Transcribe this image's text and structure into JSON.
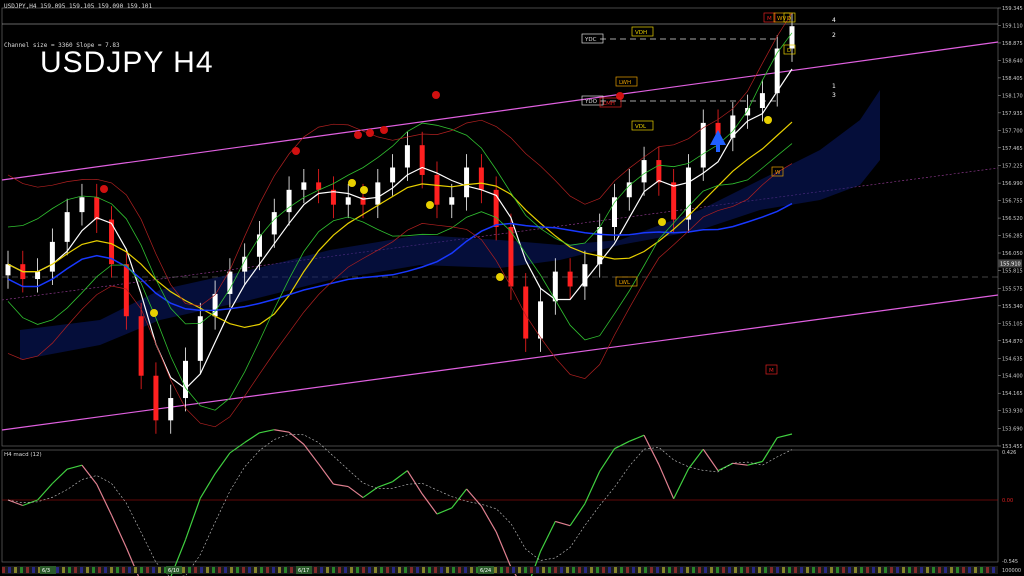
{
  "header": {
    "symbol_line": "USDJPY,H4  159.095 159.105 159.090 159.101",
    "channel_info": "Channel size = 3360 Slope = 7.83",
    "big_title": "USDJPY H4"
  },
  "price_axis": {
    "ticks": [
      "159.345",
      "159.110",
      "158.875",
      "158.640",
      "158.405",
      "158.170",
      "157.935",
      "157.700",
      "157.465",
      "157.225",
      "156.990",
      "156.755",
      "156.520",
      "156.285",
      "156.050",
      "155.815",
      "155.575",
      "155.340",
      "155.105",
      "154.870",
      "154.635",
      "154.400",
      "154.165",
      "153.930",
      "153.690",
      "153.455"
    ],
    "current_price": "155.910"
  },
  "macd_panel": {
    "label": "H4 macd (12)",
    "ticks": [
      "0.426",
      "0.00",
      "-0.545"
    ],
    "bottom": "100000"
  },
  "date_labels": [
    "6/3",
    "6/10",
    "6/17",
    "6/24"
  ],
  "level_tags": {
    "ydc": "YDC",
    "ydo": "YDO",
    "vdh": "VDH",
    "vdl": "VDL",
    "lwh": "LWH",
    "lwl": "LWL",
    "lmh": "LMH",
    "top_tags": [
      "M",
      "WV",
      "D"
    ],
    "num_1": "1",
    "num_2": "2",
    "num_3": "3",
    "num_4": "4",
    "d_tag": "D",
    "w_tag": "W",
    "m_tag": "M"
  },
  "colors": {
    "channel": "#e060e0",
    "bull": "#ffffff",
    "bear": "#ff2020",
    "ma_yellow": "#e8d000",
    "ma_blue": "#1838ff",
    "ma_white": "#ffffff",
    "bollinger": "#30c030",
    "macd_up": "#40d040",
    "macd_down": "#e08090"
  },
  "chart_data": {
    "type": "candlestick",
    "title": "USDJPY H4",
    "ylim": [
      153.455,
      159.345
    ],
    "candles_close_path": [
      155.9,
      155.7,
      155.8,
      156.2,
      156.6,
      156.8,
      156.5,
      155.9,
      155.2,
      154.4,
      153.8,
      154.1,
      154.6,
      155.2,
      155.5,
      155.8,
      156.0,
      156.3,
      156.6,
      156.9,
      157.0,
      156.9,
      156.7,
      156.8,
      156.7,
      157.0,
      157.2,
      157.5,
      157.1,
      156.7,
      156.8,
      157.2,
      156.9,
      156.4,
      155.6,
      154.9,
      155.4,
      155.8,
      155.6,
      155.9,
      156.4,
      156.8,
      157.0,
      157.3,
      157.0,
      156.5,
      157.2,
      157.8,
      157.6,
      157.9,
      158.0,
      158.2,
      158.8,
      159.1
    ],
    "rsi_markers": [
      "red-dot",
      "yellow-dot",
      "blue-arrow"
    ]
  }
}
